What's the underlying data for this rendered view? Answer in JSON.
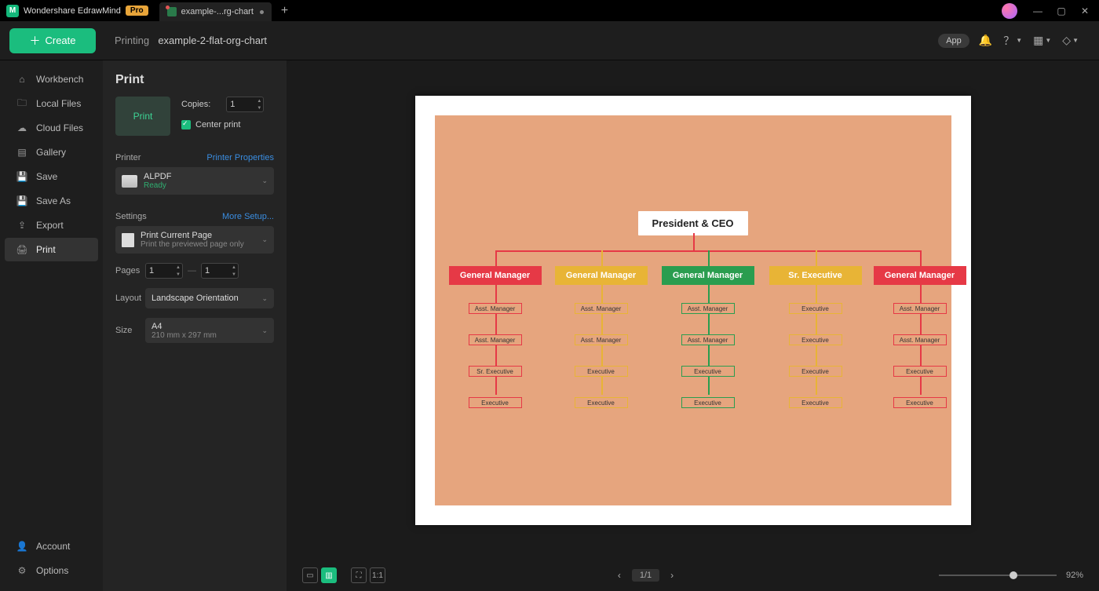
{
  "titlebar": {
    "appName": "Wondershare EdrawMind",
    "proBadge": "Pro",
    "tabName": "example-...rg-chart"
  },
  "topbar": {
    "createLabel": "Create",
    "breadcrumb": "Printing",
    "docName": "example-2-flat-org-chart",
    "appPill": "App"
  },
  "sidebar": {
    "items": [
      {
        "label": "Workbench"
      },
      {
        "label": "Local Files"
      },
      {
        "label": "Cloud Files"
      },
      {
        "label": "Gallery"
      },
      {
        "label": "Save"
      },
      {
        "label": "Save As"
      },
      {
        "label": "Export"
      },
      {
        "label": "Print"
      }
    ],
    "account": "Account",
    "options": "Options"
  },
  "panel": {
    "title": "Print",
    "printBtn": "Print",
    "copiesLabel": "Copies:",
    "copiesValue": "1",
    "centerPrint": "Center print",
    "printerLabel": "Printer",
    "printerProps": "Printer Properties",
    "printerName": "ALPDF",
    "printerStatus": "Ready",
    "settingsLabel": "Settings",
    "moreSetup": "More Setup...",
    "printCurrent": "Print Current Page",
    "printCurrentSub": "Print the previewed page only",
    "pagesLabel": "Pages",
    "pageFrom": "1",
    "pageTo": "1",
    "layoutLabel": "Layout",
    "layoutValue": "Landscape Orientation",
    "sizeLabel": "Size",
    "sizeValue": "A4",
    "sizeSub": "210 mm x 297 mm"
  },
  "chart": {
    "root": "President & CEO",
    "cols": [
      {
        "color": "red",
        "mgr": "General Manager",
        "leaves": [
          "Asst. Manager",
          "Asst. Manager",
          "Sr. Executive",
          "Executive"
        ]
      },
      {
        "color": "yel",
        "mgr": "General Manager",
        "leaves": [
          "Asst. Manager",
          "Asst. Manager",
          "Executive",
          "Executive"
        ]
      },
      {
        "color": "grn",
        "mgr": "General Manager",
        "leaves": [
          "Asst. Manager",
          "Asst. Manager",
          "Executive",
          "Executive"
        ]
      },
      {
        "color": "yel",
        "mgr": "Sr. Executive",
        "leaves": [
          "Executive",
          "Executive",
          "Executive",
          "Executive"
        ]
      },
      {
        "color": "red",
        "mgr": "General Manager",
        "leaves": [
          "Asst. Manager",
          "Asst. Manager",
          "Executive",
          "Executive"
        ]
      }
    ]
  },
  "bottombar": {
    "page": "1/1",
    "zoom": "92%"
  }
}
